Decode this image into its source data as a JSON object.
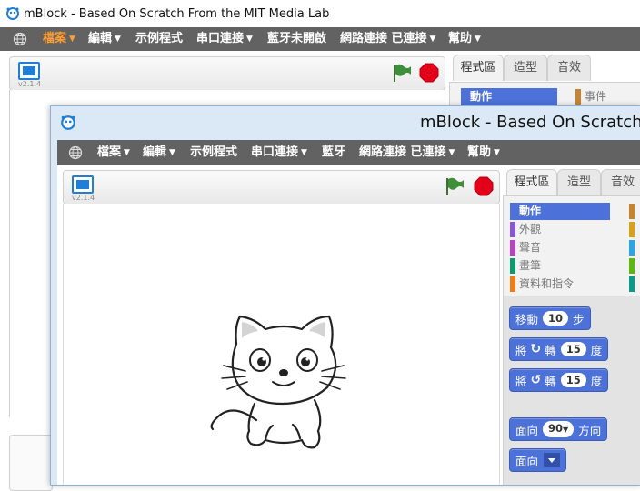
{
  "back_window": {
    "title": "mBlock - Based On Scratch From the MIT Media Lab",
    "menu": [
      {
        "label": "檔案",
        "dropdown": true,
        "active": true
      },
      {
        "label": "編輯",
        "dropdown": true
      },
      {
        "label": "示例程式",
        "dropdown": false
      },
      {
        "label": "串口連接",
        "dropdown": true
      },
      {
        "label": "藍牙未開啟",
        "dropdown": false
      },
      {
        "label": "網路連接 已連接",
        "dropdown": true
      },
      {
        "label": "幫助",
        "dropdown": true
      }
    ],
    "version": "v2.1.4",
    "tabs": [
      "程式區",
      "造型",
      "音效"
    ],
    "categories": {
      "selected": "動作",
      "right": "事件"
    }
  },
  "front_window": {
    "title": "mBlock - Based On Scratch",
    "menu": [
      {
        "label": "檔案",
        "dropdown": true
      },
      {
        "label": "編輯",
        "dropdown": true
      },
      {
        "label": "示例程式",
        "dropdown": false
      },
      {
        "label": "串口連接",
        "dropdown": true
      },
      {
        "label": "藍牙",
        "dropdown": false
      },
      {
        "label": "網路連接 已連接",
        "dropdown": true
      },
      {
        "label": "幫助",
        "dropdown": true
      }
    ],
    "version": "v2.1.4",
    "tabs": [
      "程式區",
      "造型",
      "音效"
    ],
    "categories": [
      {
        "label": "動作",
        "color": "#4c71d9",
        "selected": true
      },
      {
        "label": "外觀",
        "color": "#8a55d7"
      },
      {
        "label": "聲音",
        "color": "#bb42c3"
      },
      {
        "label": "畫筆",
        "color": "#0e9a6c"
      },
      {
        "label": "資料和指令",
        "color": "#ee7d16"
      }
    ],
    "right_category_colors": [
      "#c88330",
      "#d9a01c",
      "#2ca5e2",
      "#5cb712",
      "#0e9a8a"
    ],
    "blocks": {
      "move": {
        "prefix": "移動",
        "value": "10",
        "suffix": "步"
      },
      "turn_right": {
        "prefix": "將",
        "verb": "轉",
        "value": "15",
        "suffix": "度"
      },
      "turn_left": {
        "prefix": "將",
        "verb": "轉",
        "value": "15",
        "suffix": "度"
      },
      "point_direction": {
        "prefix": "面向",
        "value": "90",
        "suffix": "方向"
      },
      "point_towards": {
        "prefix": "面向"
      }
    }
  },
  "colors": {
    "menubar": "#626262",
    "menu_active": "#ff9d34",
    "motion_block": "#4c71d9",
    "flag": "#3f8f3a",
    "stop": "#e3001b",
    "front_frame": "#dbe8f5"
  }
}
